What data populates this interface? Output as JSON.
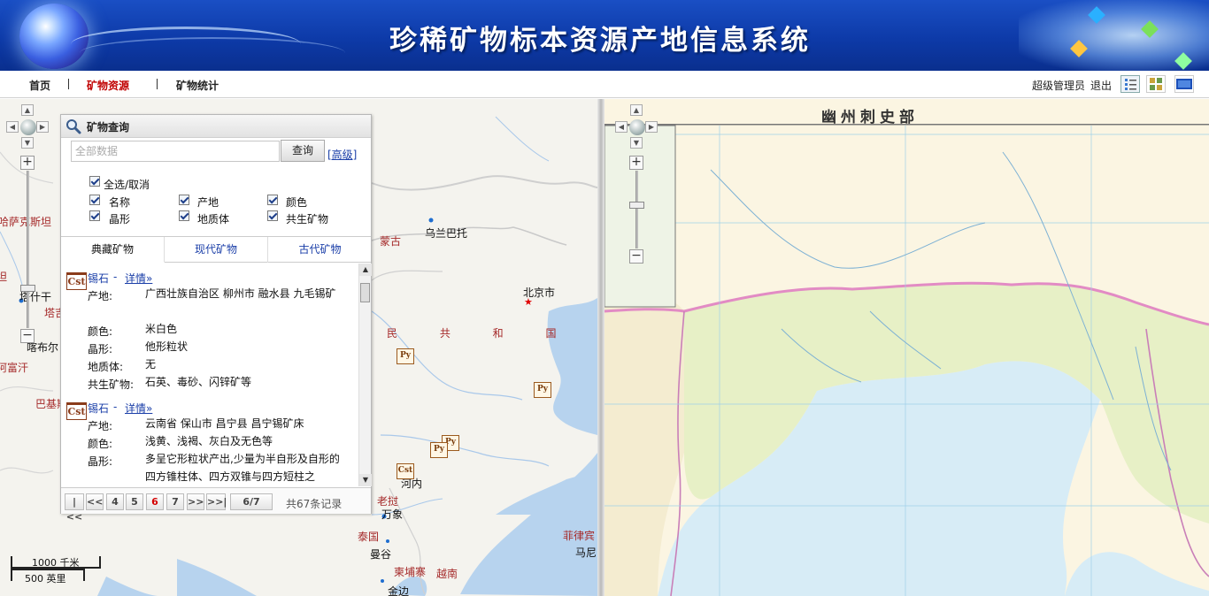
{
  "header": {
    "title": "珍稀矿物标本资源产地信息系统"
  },
  "nav": {
    "items": [
      {
        "label": "首页",
        "active": false
      },
      {
        "label": "矿物资源",
        "active": true
      },
      {
        "label": "矿物统计",
        "active": false
      }
    ],
    "user": "超级管理员",
    "logout": "退出",
    "view_buttons": [
      "list-view-icon",
      "grid-view-icon",
      "map-view-icon"
    ]
  },
  "left_map": {
    "labels": {
      "ulaanbaatar": "乌兰巴托",
      "mongolia": "蒙古",
      "beijing": "北京市",
      "prc": "民 共 和 国",
      "hanoi": "河内",
      "vientiane": "万象",
      "laos": "老挝",
      "thailand": "泰国",
      "bangkok": "曼谷",
      "cambodia": "柬埔寨",
      "vietnam": "越南",
      "phnompenh": "金边",
      "philippines": "菲律宾",
      "manila": "马尼",
      "kazakh": "哈萨克斯坦",
      "tash": "塔什干",
      "bishkek": "塔吉",
      "kabul": "喀布尔",
      "afghan": "阿富汗",
      "pakistan": "巴基斯",
      "tan": "坦"
    },
    "markers": [
      "Py",
      "Py",
      "Py",
      "Py",
      "Cst"
    ],
    "scale": {
      "km": "1000 千米",
      "mi": "500 英里"
    }
  },
  "query_panel": {
    "title": "矿物查询",
    "search_placeholder": "全部数据",
    "search_button": "查询",
    "advanced": "[高级]",
    "select_all": "全选/取消",
    "fields": [
      "名称",
      "产地",
      "颜色",
      "晶形",
      "地质体",
      "共生矿物"
    ],
    "tabs": [
      {
        "label": "典藏矿物",
        "active": true
      },
      {
        "label": "现代矿物",
        "active": false
      },
      {
        "label": "古代矿物",
        "active": false
      }
    ],
    "records": [
      {
        "badge": "Cst",
        "name": "锡石",
        "detail": "详情»",
        "rows": [
          {
            "k": "产地:",
            "v": "广西壮族自治区 柳州市 融水县 九毛锡矿"
          },
          {
            "k": "颜色:",
            "v": "米白色"
          },
          {
            "k": "晶形:",
            "v": "他形粒状"
          },
          {
            "k": "地质体:",
            "v": "无"
          },
          {
            "k": "共生矿物:",
            "v": "石英、毒砂、闪锌矿等"
          }
        ]
      },
      {
        "badge": "Cst",
        "name": "锡石",
        "detail": "详情»",
        "rows": [
          {
            "k": "产地:",
            "v": "云南省 保山市 昌宁县 昌宁锡矿床"
          },
          {
            "k": "颜色:",
            "v": "浅黄、浅褐、灰白及无色等"
          },
          {
            "k": "晶形:",
            "v": "多呈它形粒状产出,少量为半自形及自形的四方锥柱体、四方双锥与四方短柱之"
          }
        ]
      }
    ],
    "pager": {
      "first": "|<<",
      "prev": "<<",
      "pages": [
        "4",
        "5",
        "6",
        "7"
      ],
      "current": "6",
      "next": ">>",
      "last": ">>|",
      "indicator": "6/7",
      "total": "共67条记录"
    }
  },
  "right_map": {
    "title": "幽州刺史部"
  }
}
